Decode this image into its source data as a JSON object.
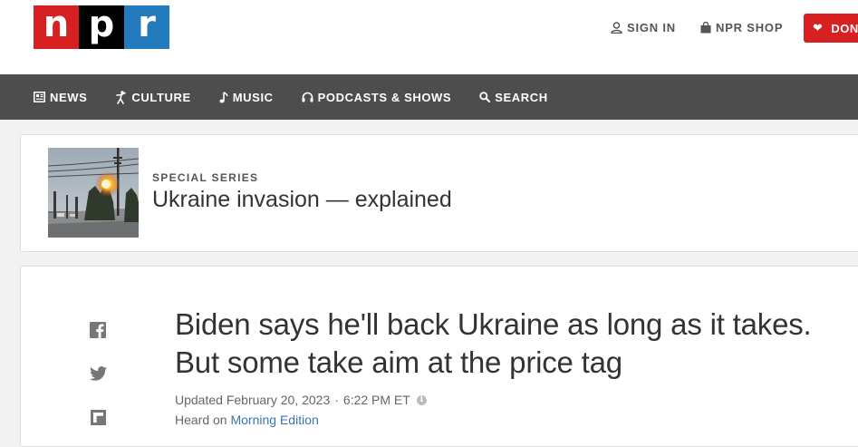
{
  "header": {
    "logo": {
      "n": "n",
      "p": "p",
      "r": "r"
    },
    "sign_in": "SIGN IN",
    "shop": "NPR SHOP",
    "donate": "DONA",
    "colors": {
      "logo_red": "#d62021",
      "logo_black": "#000000",
      "logo_blue": "#237bbd",
      "donate_bg": "#d62021"
    }
  },
  "nav": {
    "background": "#4d4d4d",
    "items": [
      {
        "label": "NEWS",
        "icon": "newspaper-icon"
      },
      {
        "label": "CULTURE",
        "icon": "culture-icon"
      },
      {
        "label": "MUSIC",
        "icon": "music-note-icon"
      },
      {
        "label": "PODCASTS & SHOWS",
        "icon": "headphones-icon"
      },
      {
        "label": "SEARCH",
        "icon": "search-icon"
      }
    ]
  },
  "series": {
    "kicker": "SPECIAL SERIES",
    "title": "Ukraine invasion — explained"
  },
  "article": {
    "headline": "Biden says he'll back Ukraine as long as it takes. But some take aim at the price tag",
    "updated": "Updated February 20, 2023",
    "separator": "·",
    "time": "6:22 PM ET",
    "heard_prefix": "Heard on",
    "program": "Morning Edition",
    "share_icons": [
      "facebook-icon",
      "twitter-icon",
      "flipboard-icon"
    ]
  }
}
